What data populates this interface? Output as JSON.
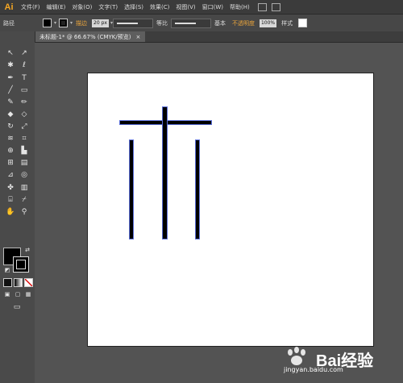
{
  "app": {
    "logo_text": "Ai"
  },
  "menus": [
    "文件(F)",
    "编辑(E)",
    "对象(O)",
    "文字(T)",
    "选择(S)",
    "效果(C)",
    "视图(V)",
    "窗口(W)",
    "帮助(H)"
  ],
  "control_bar": {
    "path_label": "路径",
    "stroke_label": "描边",
    "stroke_weight": "20 px",
    "profile_label": "等比",
    "brush_label": "基本",
    "opacity_label": "不透明度",
    "opacity_value": "100%",
    "style_label": "样式"
  },
  "document_tab": {
    "title": "未标题-1* @ 66.67% (CMYK/预览)",
    "close": "×"
  },
  "tools": [
    "selection-icon",
    "direct-selection-icon",
    "magic-wand-icon",
    "lasso-icon",
    "pen-icon",
    "type-icon",
    "line-icon",
    "rectangle-icon",
    "paintbrush-icon",
    "pencil-icon",
    "blob-brush-icon",
    "eraser-icon",
    "rotate-icon",
    "scale-icon",
    "warp-icon",
    "free-transform-icon",
    "shape-builder-icon",
    "perspective-icon",
    "mesh-icon",
    "gradient-icon",
    "eyedropper-icon",
    "blend-icon",
    "symbol-sprayer-icon",
    "graph-icon",
    "artboard-icon",
    "slice-icon",
    "hand-icon",
    "zoom-icon"
  ],
  "watermark": {
    "brand": "Bai",
    "brand_suffix": "经验",
    "url": "jingyan.baidu.com"
  }
}
